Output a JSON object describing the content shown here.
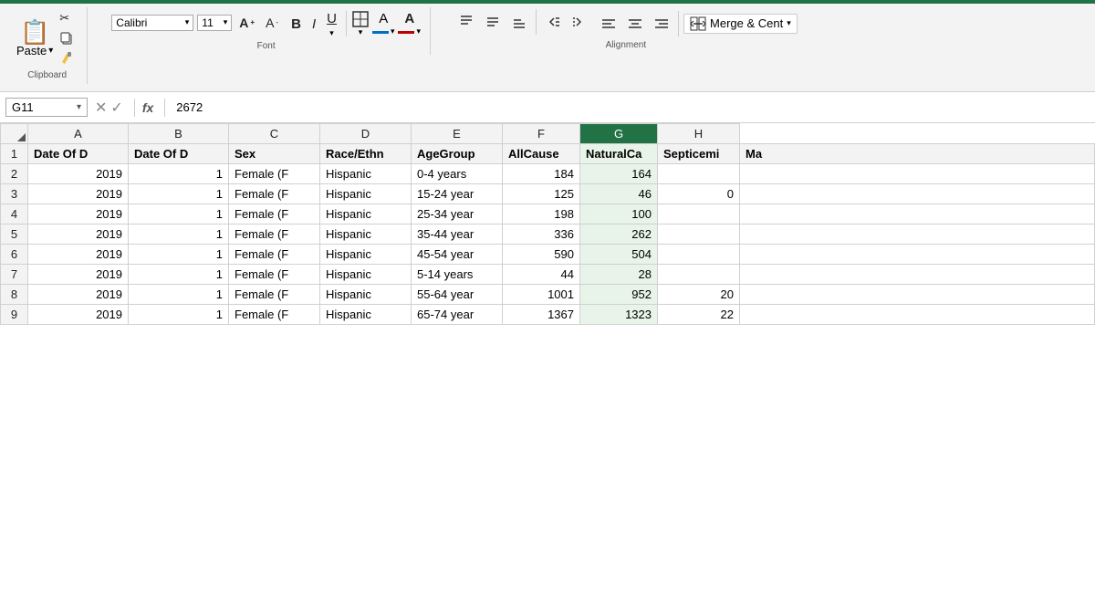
{
  "ribbon": {
    "clipboard_label": "Clipboard",
    "font_label": "Font",
    "alignment_label": "Alignment",
    "paste_label": "Paste",
    "bold_label": "B",
    "italic_label": "I",
    "underline_label": "U",
    "merge_label": "Merge & Cent",
    "fx_label": "fx"
  },
  "formula_bar": {
    "cell_ref": "G11",
    "formula_value": "2672"
  },
  "columns": {
    "corner": "",
    "headers": [
      "A",
      "B",
      "C",
      "D",
      "E",
      "F",
      "G",
      "H"
    ],
    "widths": [
      30,
      110,
      110,
      110,
      110,
      110,
      100,
      90,
      110
    ]
  },
  "rows": [
    {
      "row_num": 1,
      "cells": [
        "Date Of D",
        "Date Of D",
        "Sex",
        "Race/Ethn",
        "AgeGroup",
        "AllCause",
        "NaturalCa",
        "Septicemi",
        "Ma"
      ]
    },
    {
      "row_num": 2,
      "cells": [
        "2019",
        "1",
        "Female (F",
        "Hispanic",
        "0-4 years",
        "184",
        "164",
        "",
        ""
      ]
    },
    {
      "row_num": 3,
      "cells": [
        "2019",
        "1",
        "Female (F",
        "Hispanic",
        "15-24 year",
        "125",
        "46",
        "0",
        ""
      ]
    },
    {
      "row_num": 4,
      "cells": [
        "2019",
        "1",
        "Female (F",
        "Hispanic",
        "25-34 year",
        "198",
        "100",
        "",
        ""
      ]
    },
    {
      "row_num": 5,
      "cells": [
        "2019",
        "1",
        "Female (F",
        "Hispanic",
        "35-44 year",
        "336",
        "262",
        "",
        ""
      ]
    },
    {
      "row_num": 6,
      "cells": [
        "2019",
        "1",
        "Female (F",
        "Hispanic",
        "45-54 year",
        "590",
        "504",
        "",
        ""
      ]
    },
    {
      "row_num": 7,
      "cells": [
        "2019",
        "1",
        "Female (F",
        "Hispanic",
        "5-14 years",
        "44",
        "28",
        "",
        ""
      ]
    },
    {
      "row_num": 8,
      "cells": [
        "2019",
        "1",
        "Female (F",
        "Hispanic",
        "55-64 year",
        "1001",
        "952",
        "20",
        ""
      ]
    },
    {
      "row_num": 9,
      "cells": [
        "2019",
        "1",
        "Female (F",
        "Hispanic",
        "65-74 year",
        "1367",
        "1323",
        "22",
        ""
      ]
    }
  ],
  "selected_cell": "G11",
  "selected_col": "G",
  "selected_col_index": 6
}
